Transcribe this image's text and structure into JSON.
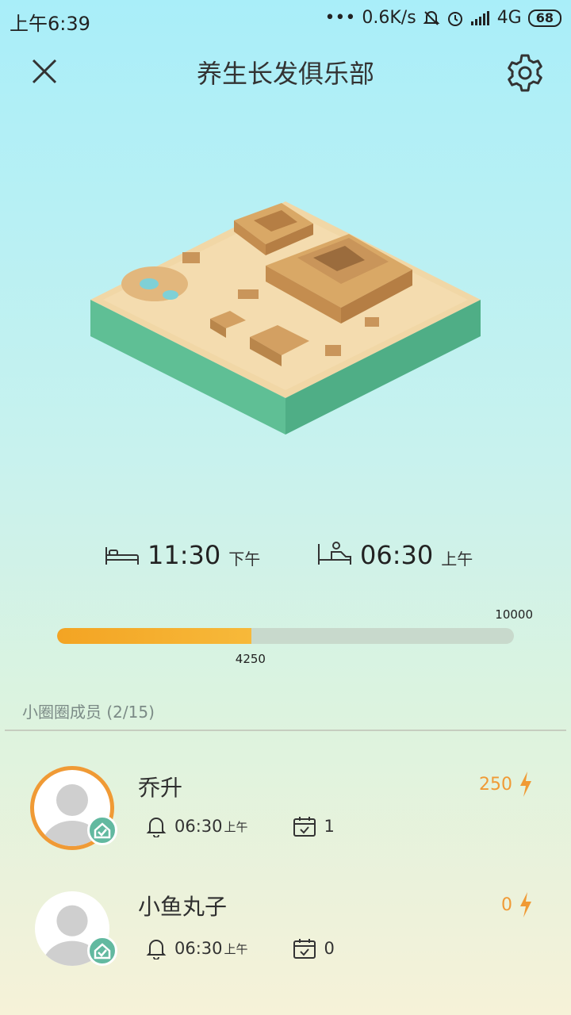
{
  "status_bar": {
    "time": "上午6:39",
    "dots": "•••",
    "speed": "0.6K/s",
    "network": "4G",
    "battery": "68"
  },
  "header": {
    "title": "养生长发俱乐部",
    "close_icon": "close-icon",
    "settings_icon": "gear-icon"
  },
  "schedule": {
    "sleep_time": "11:30",
    "sleep_period": "下午",
    "wake_time": "06:30",
    "wake_period": "上午"
  },
  "progress": {
    "max": "10000",
    "current": "4250",
    "fraction": 0.425,
    "color": "#f3a423"
  },
  "members": {
    "title": "小圈圈成员 (2/15)",
    "list": [
      {
        "name": "乔升",
        "alarm_time": "06:30",
        "alarm_period": "上午",
        "checkins": "1",
        "score": "250",
        "highlight": true
      },
      {
        "name": "小鱼丸子",
        "alarm_time": "06:30",
        "alarm_period": "上午",
        "checkins": "0",
        "score": "0",
        "highlight": false
      }
    ]
  },
  "colors": {
    "accent": "#f09a35",
    "badge": "#62b9a0",
    "island_side": "#5fbf95"
  }
}
